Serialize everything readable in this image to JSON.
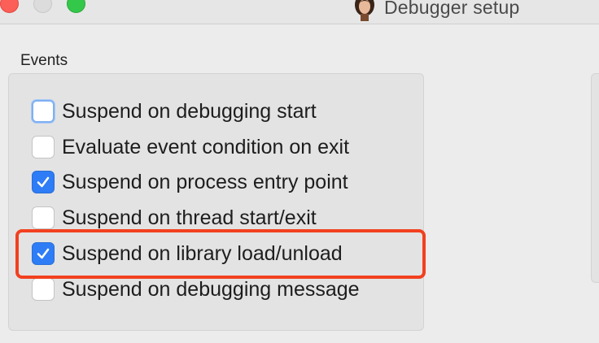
{
  "window": {
    "title": "Debugger setup",
    "app_icon": "portrait-icon"
  },
  "events_group": {
    "label": "Events",
    "options": [
      {
        "label": "Suspend on debugging start",
        "checked": false
      },
      {
        "label": "Evaluate event condition on exit",
        "checked": false
      },
      {
        "label": "Suspend on process entry point",
        "checked": true
      },
      {
        "label": "Suspend on thread start/exit",
        "checked": false
      },
      {
        "label": "Suspend on library load/unload",
        "checked": true
      },
      {
        "label": "Suspend on debugging message",
        "checked": false
      }
    ]
  },
  "colors": {
    "checkbox_checked": "#2e7cf6",
    "highlight_box": "#f2401f",
    "close_button": "#fc5f57",
    "maximize_button": "#34c84a"
  }
}
